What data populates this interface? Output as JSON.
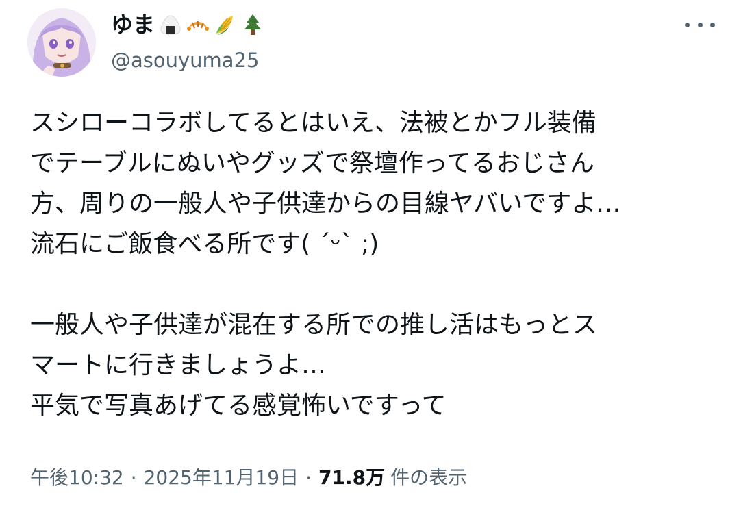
{
  "author": {
    "display_name": "ゆま",
    "emoji_icons": [
      "rice-ball-icon",
      "croissant-icon",
      "corn-icon",
      "evergreen-tree-icon"
    ],
    "handle": "@asouyuma25"
  },
  "tweet": {
    "lines": [
      "スシローコラボしてるとはいえ、法被とかフル装備",
      "でテーブルにぬいやグッズで祭壇作ってるおじさん",
      "方、周りの一般人や子供達からの目線ヤバいですよ…",
      "流石にご飯食べる所です( ´ᵕ` ;)",
      "",
      "一般人や子供達が混在する所での推し活はもっとス",
      "マートに行きましょうよ…",
      "平気で写真あげてる感覚怖いですって"
    ]
  },
  "meta": {
    "time": "午後10:32",
    "separator": "·",
    "date": "2025年11月19日",
    "views_count": "71.8万",
    "views_label": "件の表示"
  },
  "colors": {
    "text": "#0f1419",
    "secondary": "#536471",
    "background": "#ffffff"
  }
}
